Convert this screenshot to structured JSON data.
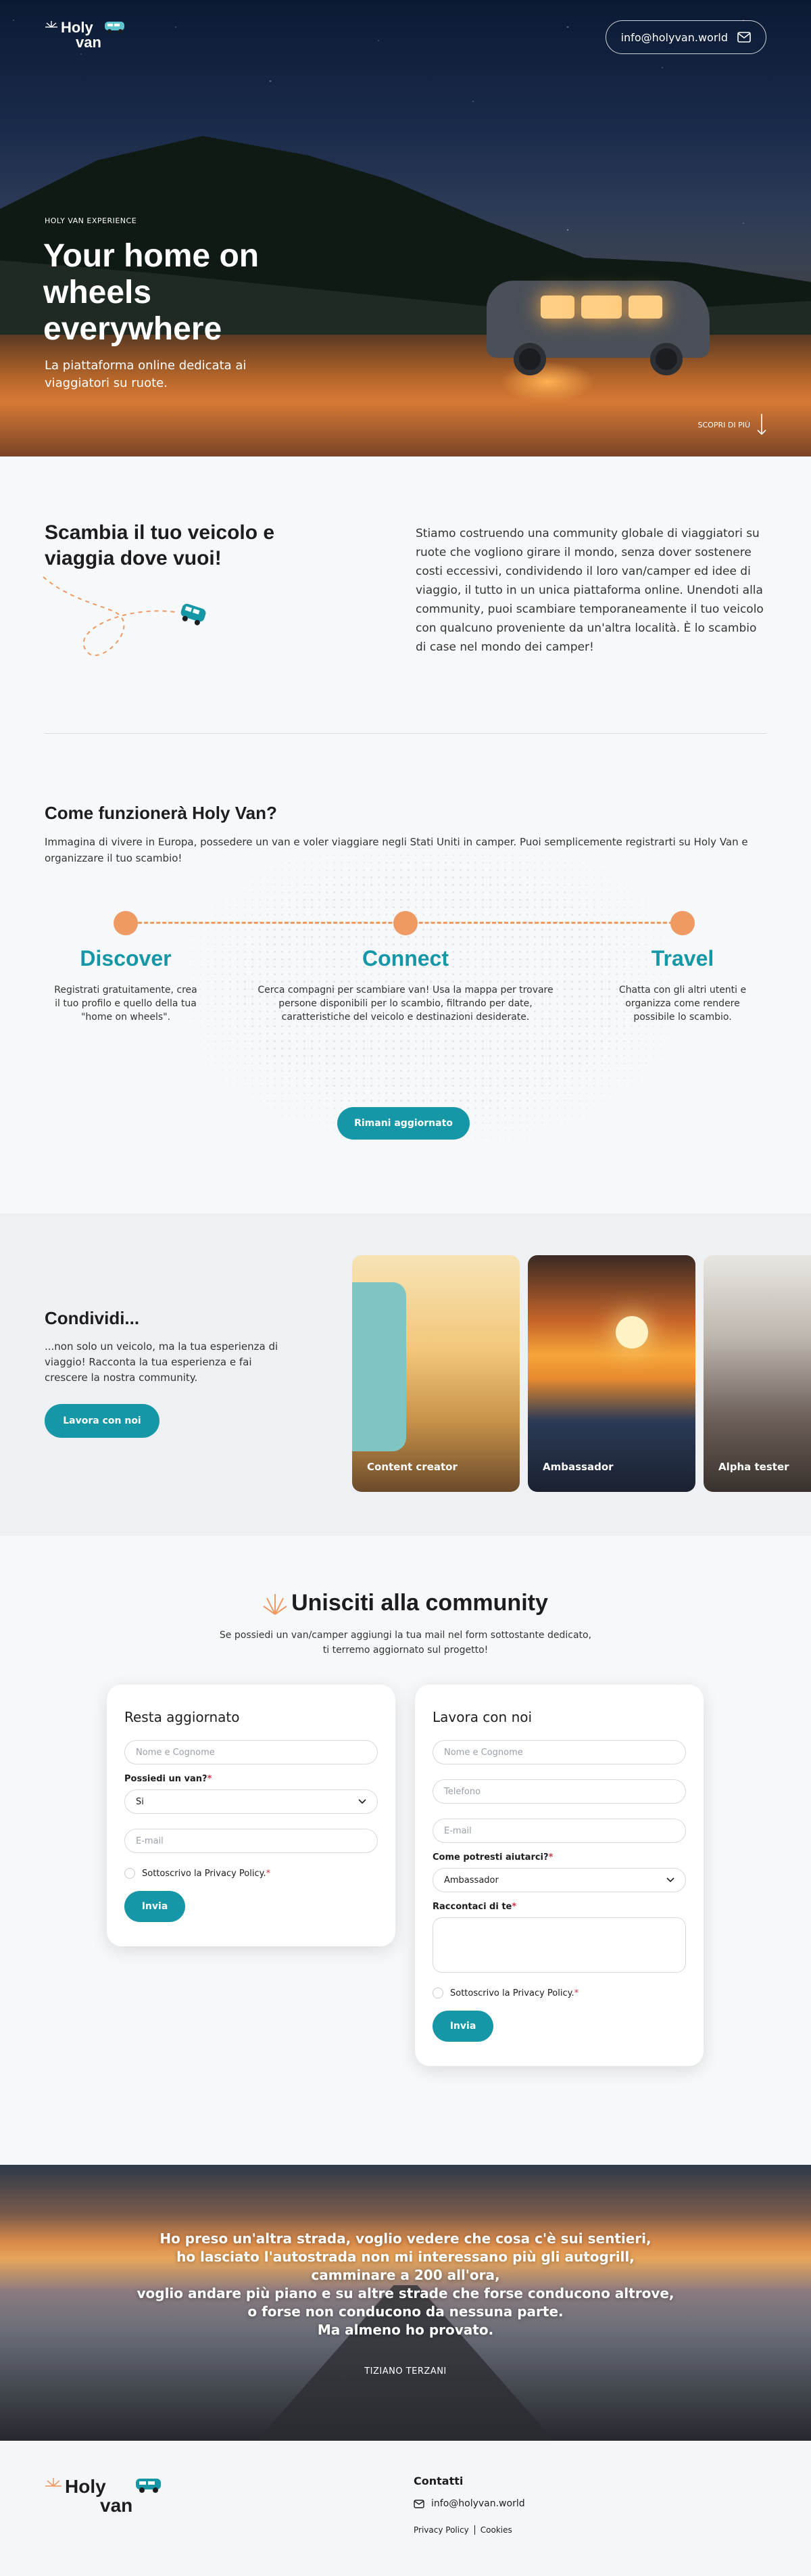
{
  "brand": {
    "logo_line1": "Holy",
    "logo_line2": "van"
  },
  "hero": {
    "email": "info@holyvan.world",
    "kicker": "HOLY VAN EXPERIENCE",
    "title": "Your home on wheels everywhere",
    "tagline": "La piattaforma online dedicata ai viaggiatori su ruote.",
    "scroll_label": "SCOPRI DI PIÙ"
  },
  "exchange": {
    "title": "Scambia il tuo veicolo e viaggia dove vuoi!",
    "body": "Stiamo costruendo una community globale di viaggiatori su ruote che vogliono girare il mondo, senza dover sostenere costi eccessivi, condividendo il loro van/camper ed idee di viaggio, il tutto in un unica piattaforma online. Unendoti alla community, puoi scambiare temporaneamente il tuo veicolo con qualcuno proveniente da un'altra località. È lo scambio di case nel mondo dei camper!"
  },
  "how": {
    "title": "Come funzionerà Holy Van?",
    "intro": "Immagina di vivere in Europa, possedere un van e voler viaggiare negli Stati Uniti in camper. Puoi semplicemente registrarti su Holy Van e organizzare il tuo scambio!",
    "steps": [
      {
        "title": "Discover",
        "text": "Registrati gratuitamente, crea il tuo profilo e quello della tua \"home on wheels\"."
      },
      {
        "title": "Connect",
        "text": "Cerca compagni per scambiare van! Usa la mappa per trovare persone disponibili per lo scambio, filtrando per date, caratteristiche del veicolo e destinazioni desiderate."
      },
      {
        "title": "Travel",
        "text": "Chatta con gli altri utenti e organizza come rendere possibile lo scambio."
      }
    ],
    "button": "Rimani aggiornato"
  },
  "share": {
    "title": "Condividi...",
    "body": "...non solo un veicolo, ma la tua esperienza di viaggio! Racconta la tua esperienza e fai crescere la nostra community.",
    "button": "Lavora con noi",
    "cards": [
      "Content creator",
      "Ambassador",
      "Alpha tester"
    ]
  },
  "community": {
    "title": "Unisciti alla community",
    "subtitle": "Se possiedi un van/camper aggiungi la tua mail nel form sottostante dedicato, ti terremo aggiornato sul progetto!",
    "form1": {
      "title": "Resta aggiornato",
      "name_placeholder": "Nome e Cognome",
      "van_label": "Possiedi un van?",
      "van_value": "Si",
      "email_placeholder": "E-mail",
      "privacy": "Sottoscrivo la Privacy Policy.",
      "submit": "Invia"
    },
    "form2": {
      "title": "Lavora con noi",
      "name_placeholder": "Nome e Cognome",
      "phone_placeholder": "Telefono",
      "email_placeholder": "E-mail",
      "help_label": "Come potresti aiutarci?",
      "help_value": "Ambassador",
      "about_label": "Raccontaci di te",
      "privacy": "Sottoscrivo la Privacy Policy.",
      "submit": "Invia"
    },
    "required_mark": "*"
  },
  "quote": {
    "lines": [
      "Ho preso un'altra strada, voglio vedere che cosa c'è sui sentieri,",
      "ho lasciato l'autostrada non mi interessano più gli autogrill,",
      "camminare a 200 all'ora,",
      "voglio andare più piano e su altre strade che forse conducono altrove,",
      "o forse non conducono da nessuna parte.",
      "Ma almeno ho provato."
    ],
    "author": "TIZIANO TERZANI"
  },
  "footer": {
    "contact_title": "Contatti",
    "email": "info@holyvan.world",
    "privacy": "Privacy Policy",
    "cookies": "Cookies"
  },
  "colors": {
    "accent": "#1597a7",
    "orange": "#ef9a63"
  },
  "icons": [
    "mail-icon",
    "arrow-down-icon",
    "chevron-down-icon",
    "van-icon",
    "sunburst-icon"
  ]
}
